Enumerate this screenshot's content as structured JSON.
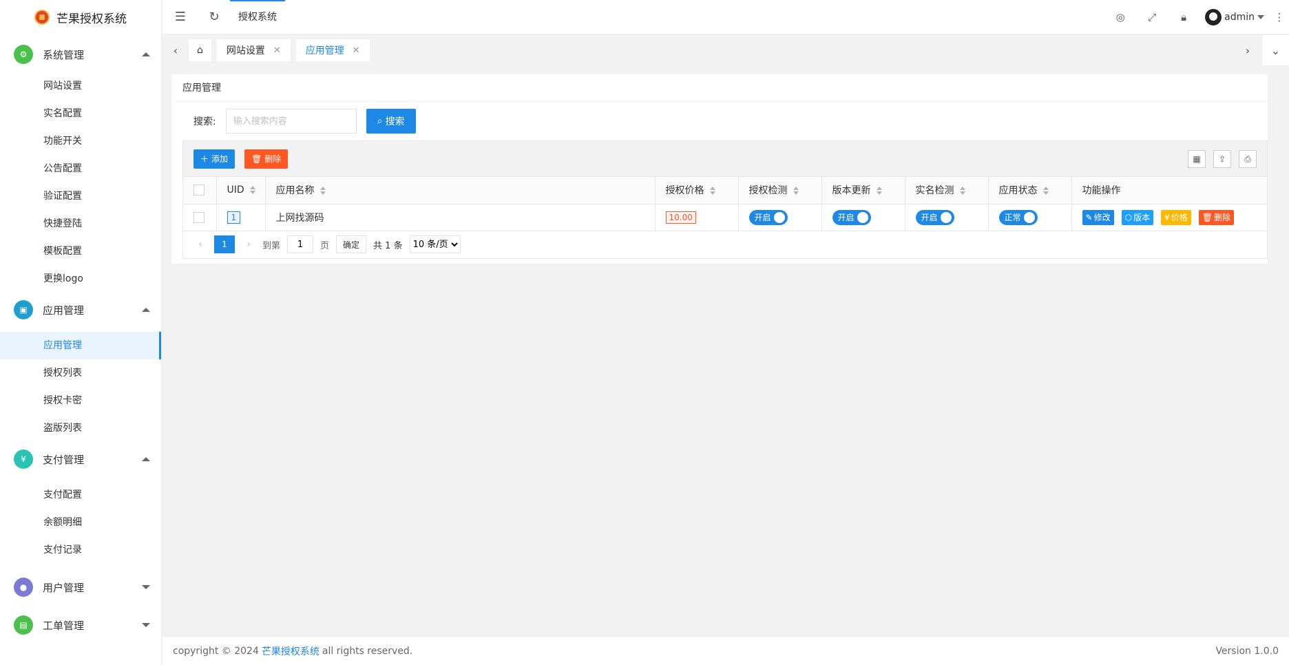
{
  "app": {
    "name": "芒果授权系统"
  },
  "sidebar": {
    "groups": [
      {
        "title": "系统管理",
        "color": "#4cc04c",
        "items": [
          "网站设置",
          "实名配置",
          "功能开关",
          "公告配置",
          "验证配置",
          "快捷登陆",
          "模板配置",
          "更换logo"
        ]
      },
      {
        "title": "应用管理",
        "color": "#1e9fcf",
        "items": [
          "应用管理",
          "授权列表",
          "授权卡密",
          "盗版列表"
        ]
      },
      {
        "title": "支付管理",
        "color": "#2bc4b4",
        "items": [
          "支付配置",
          "余额明细",
          "支付记录"
        ]
      },
      {
        "title": "用户管理",
        "color": "#7b7bd6"
      },
      {
        "title": "工单管理",
        "color": "#4cc04c"
      }
    ]
  },
  "header": {
    "tab": "授权系统",
    "user": "admin"
  },
  "tabs": [
    {
      "label": "网站设置"
    },
    {
      "label": "应用管理"
    }
  ],
  "card": {
    "title": "应用管理"
  },
  "search": {
    "label": "搜索:",
    "placeholder": "输入搜索内容",
    "button": "搜索"
  },
  "toolbar": {
    "add": "添加",
    "delete": "删除"
  },
  "table": {
    "headers": [
      "UID",
      "应用名称",
      "授权价格",
      "授权检测",
      "版本更新",
      "实名检测",
      "应用状态",
      "功能操作"
    ],
    "rows": [
      {
        "uid": "1",
        "name": "上网找源码",
        "price": "10.00",
        "auth_check": "开启",
        "version_update": "开启",
        "realname_check": "开启",
        "status": "正常",
        "ops": [
          "修改",
          "版本",
          "价格",
          "删除"
        ]
      }
    ]
  },
  "pager": {
    "current": "1",
    "goto_label": "到第",
    "goto_value": "1",
    "page_unit": "页",
    "confirm": "确定",
    "total": "共 1 条",
    "per_page": "10 条/页"
  },
  "footer": {
    "prefix": "copyright © 2024",
    "link": "芒果授权系统",
    "suffix": "all rights reserved.",
    "version": "Version 1.0.0"
  }
}
